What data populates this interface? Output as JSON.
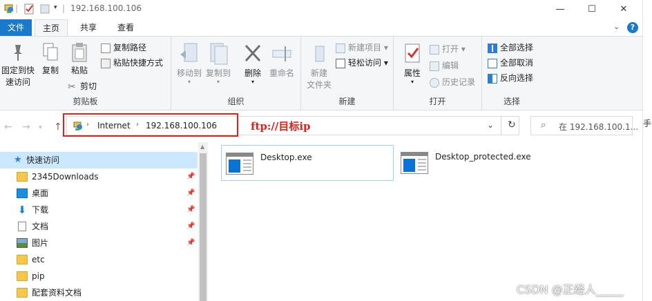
{
  "window": {
    "title": "192.168.100.106",
    "controls": {
      "minimize": "—",
      "maximize": "☐",
      "close": "✕"
    }
  },
  "tabs": [
    {
      "label": "文件"
    },
    {
      "label": "主页"
    },
    {
      "label": "共享"
    },
    {
      "label": "查看"
    }
  ],
  "ribbon": {
    "clipboard": {
      "label": "剪贴板",
      "pin": "固定到快",
      "pin2": "速访问",
      "copy": "复制",
      "paste": "粘贴",
      "copy_path": "复制路径",
      "paste_shortcut": "粘贴快捷方式",
      "cut": "剪切"
    },
    "organize": {
      "label": "组织",
      "move_to": "移动到",
      "copy_to": "复制到",
      "delete": "删除",
      "rename": "重命名"
    },
    "new": {
      "label": "新建",
      "new_folder": "新建",
      "new_folder2": "文件夹",
      "new_item": "新建项目",
      "easy_access": "轻松访问"
    },
    "open": {
      "label": "打开",
      "properties": "属性",
      "open": "打开",
      "edit": "编辑",
      "history": "历史记录"
    },
    "select": {
      "label": "选择",
      "select_all": "全部选择",
      "select_none": "全部取消",
      "invert": "反向选择"
    }
  },
  "address": {
    "segments": [
      "Internet",
      "192.168.100.106"
    ],
    "annotation": "ftp://目标ip",
    "search_placeholder": "在 192.168.100.1..."
  },
  "nav": {
    "quick_access": "快速访问",
    "items": [
      {
        "label": "2345Downloads",
        "icon": "folder-icon",
        "pinned": true
      },
      {
        "label": "桌面",
        "icon": "desktop-icon",
        "pinned": true
      },
      {
        "label": "下载",
        "icon": "download-icon",
        "pinned": true
      },
      {
        "label": "文档",
        "icon": "document-icon",
        "pinned": true
      },
      {
        "label": "图片",
        "icon": "picture-icon",
        "pinned": true
      },
      {
        "label": "etc",
        "icon": "folder-icon",
        "pinned": false
      },
      {
        "label": "pip",
        "icon": "folder-icon",
        "pinned": false
      },
      {
        "label": "配套资料文档",
        "icon": "folder-icon",
        "pinned": false
      }
    ]
  },
  "files": [
    {
      "name": "Desktop.exe"
    },
    {
      "name": "Desktop_protected.exe"
    }
  ],
  "watermark": "CSDN @正经人_____",
  "edge_text": "手",
  "colors": {
    "accent": "#1979ca",
    "highlight": "#e0201a",
    "selection": "#cce8ff"
  }
}
